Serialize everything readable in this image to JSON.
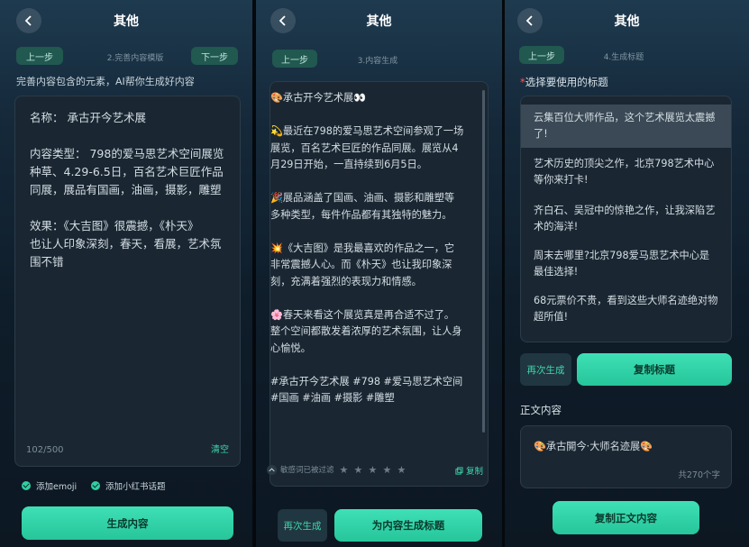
{
  "header": {
    "title": "其他"
  },
  "step1": {
    "prev": "上一步",
    "label": "2.完善内容模版",
    "next": "下一步",
    "hint": "完善内容包含的元素，AI帮你生成好内容",
    "lines": [
      "名称： 承古开今艺术展",
      "",
      "内容类型： 798的爱马思艺术空间展览",
      "种草、4.29-6.5日，百名艺术巨匠作品",
      "同展，展品有国画，油画，摄影，雕塑",
      "",
      "效果：《大吉图》很震撼，《朴天》",
      "也让人印象深刻，春天，看展，艺术氛",
      "围不错"
    ],
    "counter": "102/500",
    "clear": "清空",
    "opt_emoji": "添加emoji",
    "opt_topic": "添加小红书话题",
    "generate": "生成内容"
  },
  "step2": {
    "prev": "上一步",
    "label": "3.内容生成",
    "paragraphs": [
      "🎨承古开今艺术展👀",
      "💫最近在798的爱马思艺术空间参观了一场展览，百名艺术巨匠的作品同展。展览从4月29日开始，一直持续到6月5日。",
      "🎉展品涵盖了国画、油画、摄影和雕塑等多种类型，每件作品都有其独特的魅力。",
      "💥《大吉图》是我最喜欢的作品之一，它非常震撼人心。而《朴天》也让我印象深刻，充满着强烈的表现力和情感。",
      "🌸春天来看这个展览真是再合适不过了。整个空间都散发着浓厚的艺术氛围，让人身心愉悦。",
      "#承古开今艺术展 #798 #爱马思艺术空间 #国画 #油画 #摄影 #雕塑"
    ],
    "sensitive": "敏感词已被过滤",
    "rating": 0,
    "copy": "复制",
    "regenerate": "再次生成",
    "gen_title": "为内容生成标题"
  },
  "step3": {
    "prev": "上一步",
    "label": "4.生成标题",
    "select_label": "选择要使用的标题",
    "titles": [
      "云集百位大师作品，这个艺术展览太震撼了!",
      "艺术历史的顶尖之作，北京798艺术中心等你来打卡!",
      "齐白石、吴冠中的惊艳之作，让我深陷艺术的海洋!",
      "周末去哪里?北京798爱马思艺术中心是最佳选择!",
      "68元票价不贵，看到这些大师名迹绝对物超所值!"
    ],
    "regenerate": "再次生成",
    "copy_title": "复制标题",
    "body_label": "正文内容",
    "body_preview": "🎨承古開今·大师名迹展🎨",
    "body_count": "共270个字",
    "copy_body": "复制正文内容"
  }
}
